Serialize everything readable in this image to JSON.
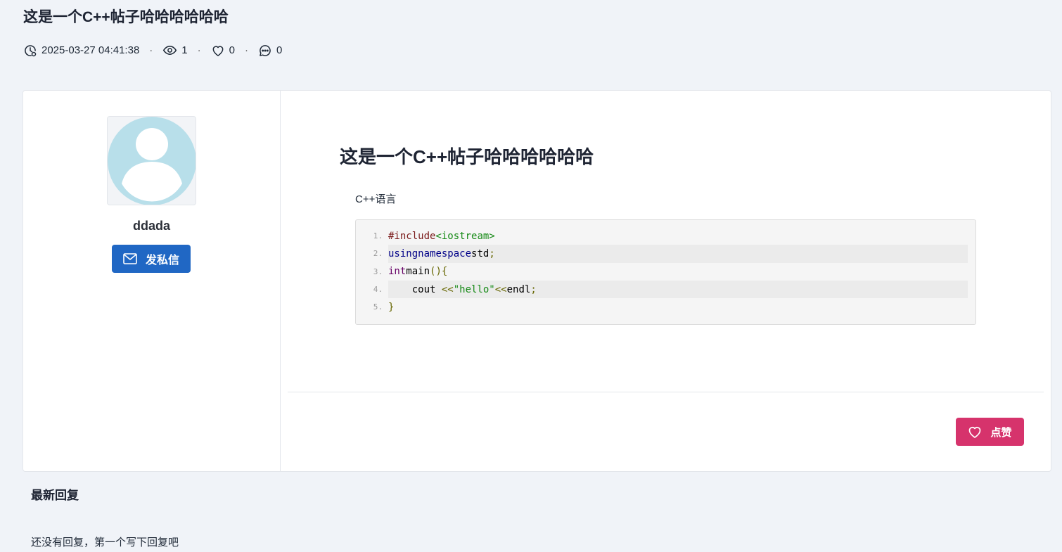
{
  "post": {
    "title": "这是一个C++帖子哈哈哈哈哈哈",
    "timestamp": "2025-03-27 04:41:38",
    "views": "1",
    "likes": "0",
    "comments": "0",
    "heading": "这是一个C++帖子哈哈哈哈哈哈",
    "language_label": "C++语言",
    "like_button_label": "点赞"
  },
  "author": {
    "name": "ddada",
    "dm_button_label": "发私信"
  },
  "code": {
    "line_numbers": [
      "1.",
      "2.",
      "3.",
      "4.",
      "5."
    ],
    "lines": [
      "#include<iostream>",
      "using namespace std;",
      "int main(){",
      "    cout <<\"hello\"<<endl;",
      "}"
    ]
  },
  "replies": {
    "title": "最新回复",
    "empty_text": "还没有回复，第一个写下回复吧"
  },
  "colors": {
    "page_bg": "#f0f3f8",
    "primary": "#2067c4",
    "like": "#d6336c",
    "avatar": "#b8dfea"
  },
  "icons": [
    "clock-icon",
    "eye-icon",
    "heart-icon",
    "comment-icon",
    "mail-icon",
    "avatar-placeholder-icon"
  ]
}
